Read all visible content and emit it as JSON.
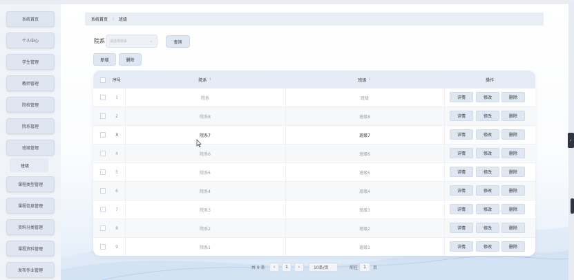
{
  "sidebar": {
    "items": [
      {
        "label": "系统首页"
      },
      {
        "label": "个人中心"
      },
      {
        "label": "学生管理"
      },
      {
        "label": "教师管理"
      },
      {
        "label": "院校管理"
      },
      {
        "label": "院系管理"
      },
      {
        "label": "班级管理"
      },
      {
        "label": "课程类型管理"
      },
      {
        "label": "课程信息管理"
      },
      {
        "label": "资料分类管理"
      },
      {
        "label": "课程资料管理"
      },
      {
        "label": "发布作业管理"
      }
    ],
    "active_sub": "班级"
  },
  "breadcrumb": {
    "home": "系统首页",
    "sep": "⋮",
    "current": "班级"
  },
  "filter": {
    "label": "院系",
    "placeholder": "请选择院系",
    "query_button": "查询"
  },
  "actions": {
    "add": "新增",
    "delete": "删除"
  },
  "table": {
    "headers": {
      "index": "序号",
      "department": "院系",
      "class": "班级",
      "operation": "操作"
    },
    "row_buttons": {
      "detail": "详情",
      "edit": "修改",
      "delete": "删除"
    },
    "rows": [
      {
        "index": "1",
        "department": "院系",
        "class": "班级"
      },
      {
        "index": "2",
        "department": "院系8",
        "class": "班级8"
      },
      {
        "index": "3",
        "department": "院系7",
        "class": "班级7"
      },
      {
        "index": "4",
        "department": "院系6",
        "class": "班级6"
      },
      {
        "index": "5",
        "department": "院系5",
        "class": "班级5"
      },
      {
        "index": "6",
        "department": "院系4",
        "class": "班级4"
      },
      {
        "index": "7",
        "department": "院系3",
        "class": "班级3"
      },
      {
        "index": "8",
        "department": "院系2",
        "class": "班级2"
      },
      {
        "index": "9",
        "department": "院系1",
        "class": "班级1"
      }
    ]
  },
  "pagination": {
    "total": "共 9 条",
    "prev": "‹",
    "current_page": "1",
    "next": "›",
    "page_size": "10条/页",
    "goto_prefix": "前往",
    "goto_value": "1",
    "goto_suffix": "页"
  }
}
